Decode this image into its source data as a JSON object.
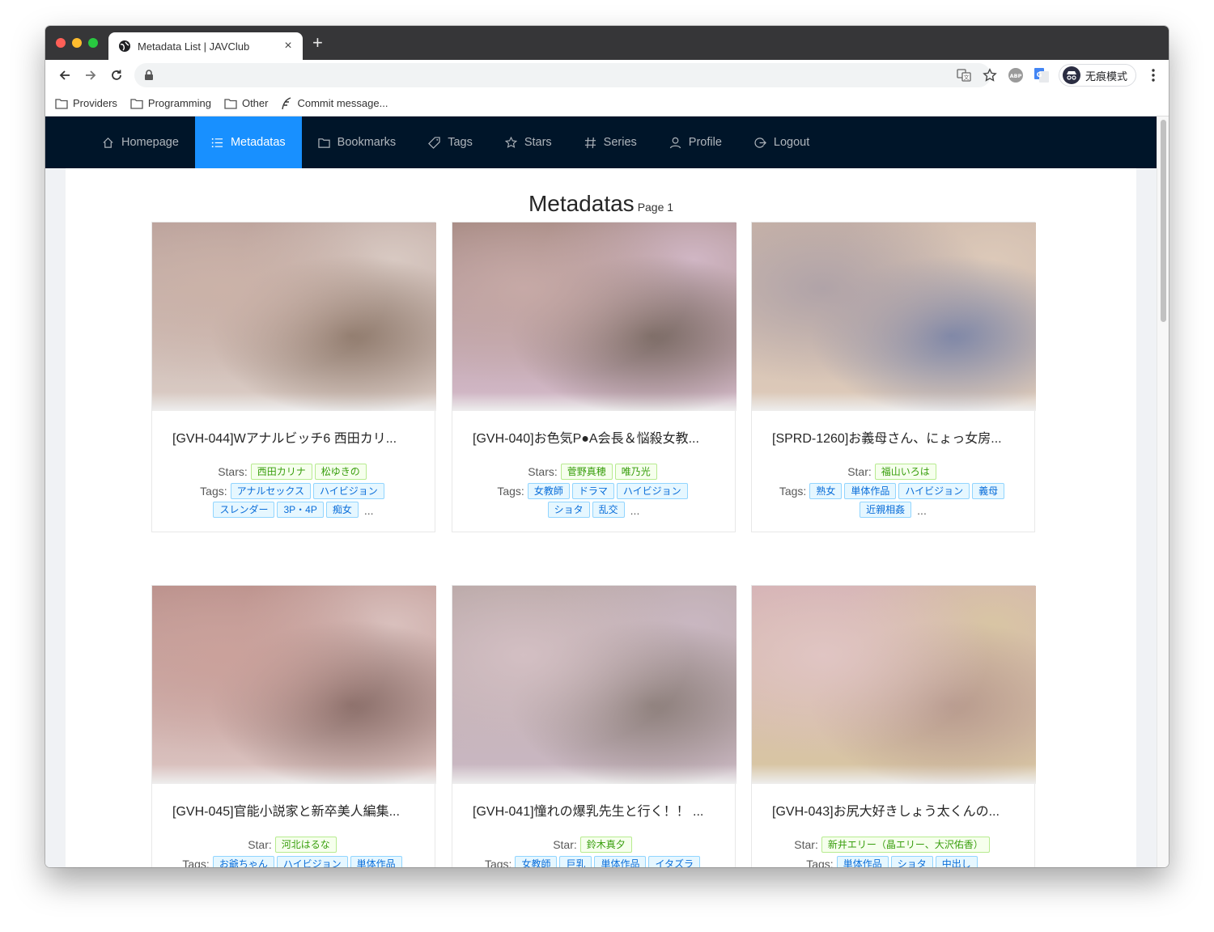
{
  "browser": {
    "tab_title": "Metadata List | JAVClub",
    "new_tab_label": "+",
    "close_label": "×",
    "incognito_label": "无痕模式",
    "bookmarks": [
      {
        "label": "Providers",
        "icon": "folder-icon"
      },
      {
        "label": "Programming",
        "icon": "folder-icon"
      },
      {
        "label": "Other",
        "icon": "folder-icon"
      },
      {
        "label": "Commit message...",
        "icon": "feather-icon"
      }
    ]
  },
  "nav": {
    "items": [
      {
        "label": "Homepage",
        "icon": "home-icon",
        "active": false
      },
      {
        "label": "Metadatas",
        "icon": "list-icon",
        "active": true
      },
      {
        "label": "Bookmarks",
        "icon": "folder-icon",
        "active": false
      },
      {
        "label": "Tags",
        "icon": "tag-icon",
        "active": false
      },
      {
        "label": "Stars",
        "icon": "star-icon",
        "active": false
      },
      {
        "label": "Series",
        "icon": "hash-icon",
        "active": false
      },
      {
        "label": "Profile",
        "icon": "user-icon",
        "active": false
      },
      {
        "label": "Logout",
        "icon": "logout-icon",
        "active": false
      }
    ],
    "active_color": "#1890ff",
    "bg_color": "#001529"
  },
  "page": {
    "title": "Metadatas",
    "subtitle": "Page 1"
  },
  "cards": [
    {
      "title": "[GVH-044]Wアナルビッチ6 西田カリ...",
      "star_label": "Stars:",
      "stars": [
        "西田カリナ",
        "松ゆきの"
      ],
      "tags_label": "Tags:",
      "tags": [
        "アナルセックス",
        "ハイビジョン",
        "スレンダー",
        "3P・4P",
        "痴女"
      ],
      "more": "...",
      "cover_colors": [
        "#b9a09a",
        "#cbb2a8",
        "#8f7a6c",
        "#d8c9c2"
      ]
    },
    {
      "title": "[GVH-040]お色気P●A会長＆悩殺女教...",
      "star_label": "Stars:",
      "stars": [
        "菅野真穂",
        "唯乃光"
      ],
      "tags_label": "Tags:",
      "tags": [
        "女教師",
        "ドラマ",
        "ハイビジョン",
        "ショタ",
        "乱交"
      ],
      "more": "...",
      "cover_colors": [
        "#a3877f",
        "#c6a9a6",
        "#7a6a64",
        "#d0b6c4"
      ]
    },
    {
      "title": "[SPRD-1260]お義母さん、にょっ女房...",
      "star_label": "Star:",
      "stars": [
        "福山いろは"
      ],
      "tags_label": "Tags:",
      "tags": [
        "熟女",
        "単体作品",
        "ハイビジョン",
        "義母",
        "近親相姦"
      ],
      "more": "...",
      "cover_colors": [
        "#c9b3a7",
        "#b0a3a8",
        "#7d86a7",
        "#dcc9b9"
      ]
    },
    {
      "title": "[GVH-045]官能小説家と新卒美人編集...",
      "star_label": "Star:",
      "stars": [
        "河北はるな"
      ],
      "tags_label": "Tags:",
      "tags": [
        "お爺ちゃん",
        "ハイビジョン",
        "単体作品"
      ],
      "more": "",
      "cover_colors": [
        "#b98f8a",
        "#caa19b",
        "#8a6e69",
        "#d9c0bd"
      ]
    },
    {
      "title": "[GVH-041]憧れの爆乳先生と行く！！ ...",
      "star_label": "Star:",
      "stars": [
        "鈴木真夕"
      ],
      "tags_label": "Tags:",
      "tags": [
        "女教師",
        "巨乳",
        "単体作品",
        "イタズラ"
      ],
      "more": "",
      "cover_colors": [
        "#b7a6a4",
        "#d3bfc3",
        "#8c7e7a",
        "#c9b7c1"
      ]
    },
    {
      "title": "[GVH-043]お尻大好きしょう太くんの...",
      "star_label": "Star:",
      "stars": [
        "新井エリー（晶エリー、大沢佑香）"
      ],
      "tags_label": "Tags:",
      "tags": [
        "単体作品",
        "ショタ",
        "中出し"
      ],
      "more": "",
      "cover_colors": [
        "#d4b0b4",
        "#e0c5c3",
        "#b79a8d",
        "#d8c5a4"
      ]
    }
  ]
}
